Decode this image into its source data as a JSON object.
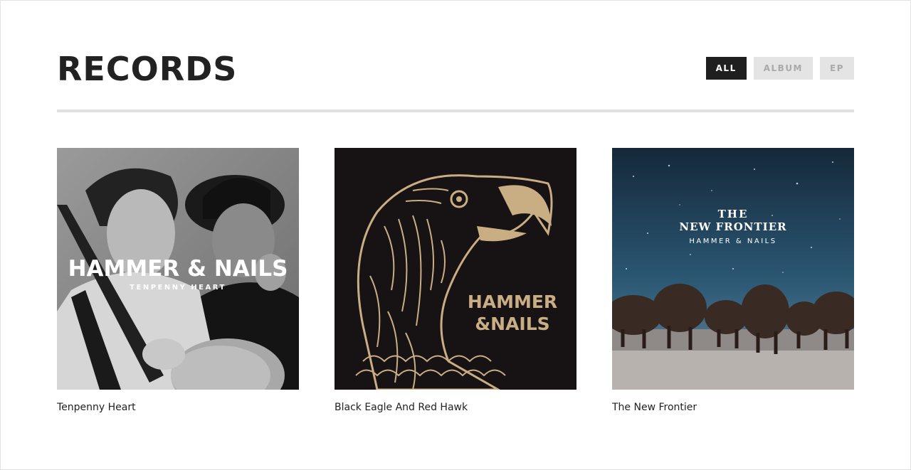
{
  "page": {
    "title": "RECORDS"
  },
  "filters": [
    {
      "label": "ALL",
      "active": true
    },
    {
      "label": "ALBUM",
      "active": false
    },
    {
      "label": "EP",
      "active": false
    }
  ],
  "records": [
    {
      "title": "Tenpenny Heart",
      "cover": {
        "band": "HAMMER & NAILS",
        "album": "TENPENNY HEART"
      }
    },
    {
      "title": "Black Eagle And Red Hawk",
      "cover": {
        "band_line1": "HAMMER",
        "band_line2": "&NAILS"
      }
    },
    {
      "title": "The New Frontier",
      "cover": {
        "album_line1": "THE",
        "album_line2": "NEW FRONTIER",
        "band": "HAMMER & NAILS"
      }
    }
  ],
  "colors": {
    "title_text": "#222222",
    "filter_active_bg": "#1f1f1f",
    "filter_inactive_bg": "#e4e4e4",
    "eagle_gold": "#c9ad83",
    "frontier_sky": "#1c3a4e"
  }
}
